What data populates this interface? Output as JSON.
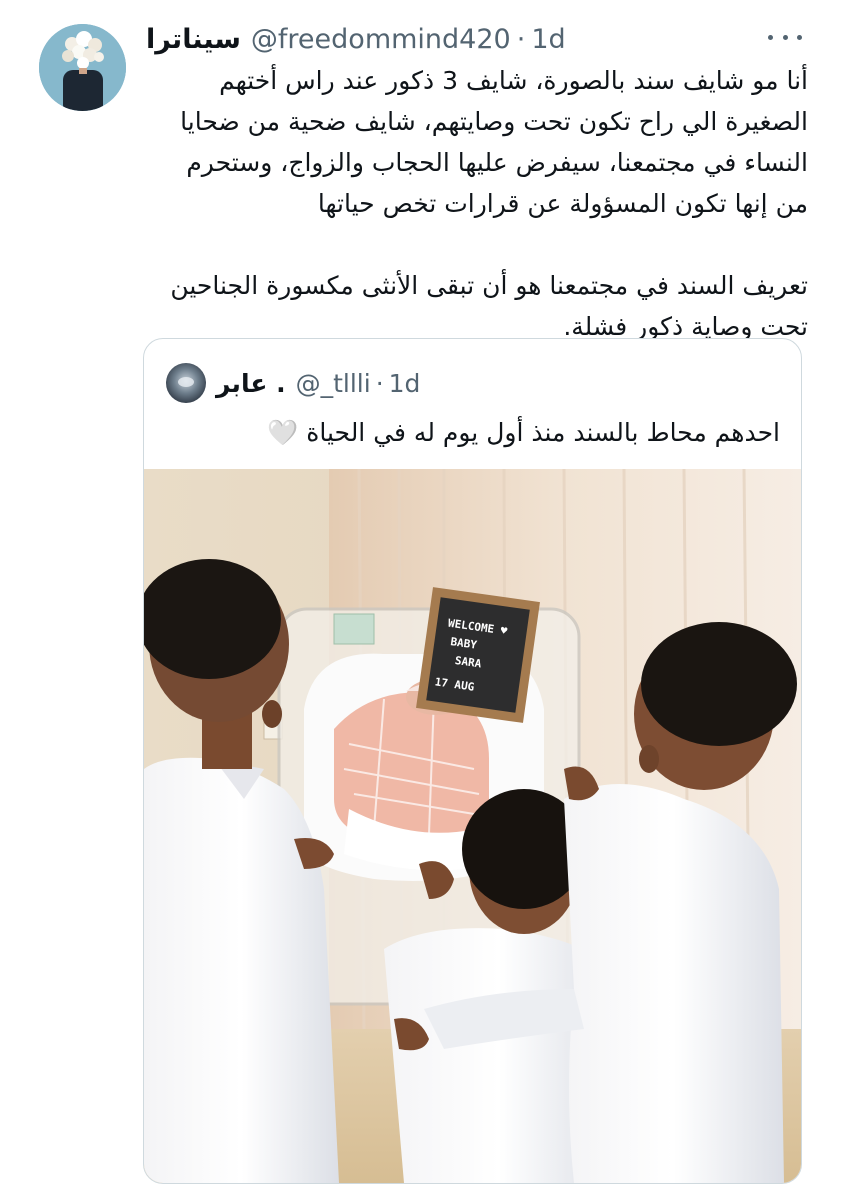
{
  "tweet": {
    "display_name": "سيناترا",
    "handle": "@freedommind420",
    "separator": "·",
    "time": "1d",
    "paragraph_1": "أنا مو شايف سند بالصورة، شايف 3 ذكور عند راس أختهم الصغيرة الي راح تكون تحت وصايتهم، شايف ضحية من ضحايا النساء في مجتمعنا، سيفرض عليها الحجاب والزواج، وستحرم من إنها تكون المسؤولة عن قرارات تخص حياتها",
    "paragraph_2": "تعريف السند في مجتمعنا هو أن تبقى الأنثى مكسورة الجناحين تحت وصاية ذكور فشلة."
  },
  "quoted": {
    "display_name": "عابر .",
    "handle": "@_tllli",
    "separator": "·",
    "time": "1d",
    "text": "احدهم محاط بالسند منذ أول يوم له في الحياة 🤍"
  },
  "letter_board": {
    "line1": "WELCOME ♥",
    "line2": "BABY",
    "line3": "SARA",
    "line4": "17 AUG"
  },
  "icons": {
    "more": "more-horizontal-icon"
  }
}
